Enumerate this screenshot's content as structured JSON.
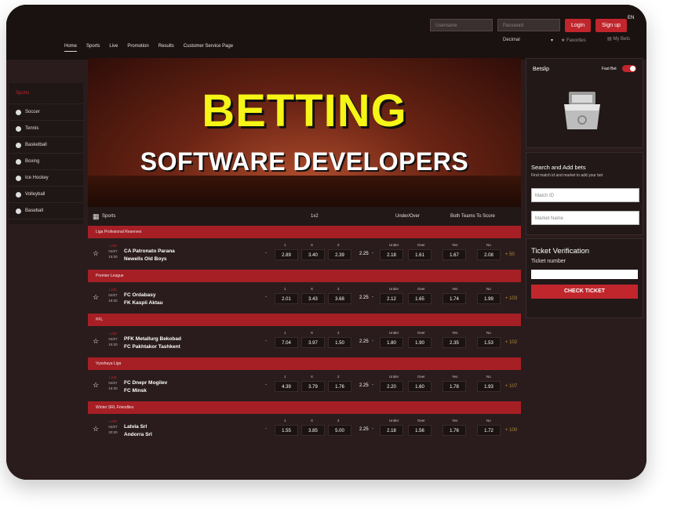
{
  "header": {
    "nav": [
      "Home",
      "Sports",
      "Live",
      "Promotion",
      "Results",
      "Customer Service Page"
    ],
    "username_placeholder": "Username",
    "password_placeholder": "Password",
    "login_label": "Login",
    "signup_label": "Sign up",
    "language": "EN",
    "odds_format": "Decimal",
    "favorites_label": "Favorites",
    "my_bets_label": "My Bets"
  },
  "sidebar": {
    "title": "Sports",
    "items": [
      "Soccer",
      "Tennis",
      "Basketball",
      "Boxing",
      "Ice Hockey",
      "Volleyball",
      "Baseball"
    ]
  },
  "banner": {
    "line1": "BETTING",
    "line2": "SOFTWARE DEVELOPERS"
  },
  "table": {
    "headers": {
      "sports": "Sports",
      "market1": "1x2",
      "market2": "Under/Over",
      "market3": "Both Teams To Score"
    },
    "odd_headers": {
      "h1": "1",
      "hx": "X",
      "h2": "2",
      "under": "Under",
      "over": "Over",
      "yes": "Yes",
      "no": "No"
    },
    "matches": [
      {
        "league": "Liga Profesional Reserves",
        "live": "LIVE",
        "date": "04/07",
        "time": "19:30",
        "home": "CA Patronato Parana",
        "away": "Newells Old Boys",
        "o1": "2.89",
        "ox": "3.40",
        "o2": "2.39",
        "handicap": "2.25",
        "under": "2.18",
        "over": "1.61",
        "yes": "1.67",
        "no": "2.08",
        "more": "+ 50"
      },
      {
        "league": "Premier League",
        "live": "LIVE",
        "date": "04/07",
        "time": "19:30",
        "home": "FC Ordabasy",
        "away": "FK Kaspii Aktau",
        "o1": "2.01",
        "ox": "3.43",
        "o2": "3.68",
        "handicap": "2.25",
        "under": "2.12",
        "over": "1.65",
        "yes": "1.74",
        "no": "1.99",
        "more": "+ 103"
      },
      {
        "league": "PFL",
        "live": "LIVE",
        "date": "04/07",
        "time": "19:30",
        "home": "PFK Metallurg Bekobad",
        "away": "FC Pakhtakor Tashkent",
        "o1": "7.04",
        "ox": "3.97",
        "o2": "1.50",
        "handicap": "2.25",
        "under": "1.80",
        "over": "1.90",
        "yes": "2.35",
        "no": "1.53",
        "more": "+ 102"
      },
      {
        "league": "Vysshaya Liga",
        "live": "LIVE",
        "date": "04/07",
        "time": "19:30",
        "home": "FC Dnepr Mogilev",
        "away": "FC Minsk",
        "o1": "4.39",
        "ox": "3.79",
        "o2": "1.76",
        "handicap": "2.25",
        "under": "2.20",
        "over": "1.60",
        "yes": "1.78",
        "no": "1.93",
        "more": "+ 107"
      },
      {
        "league": "Winter SRL Friendlies",
        "live": "LIVE",
        "date": "04/07",
        "time": "20:30",
        "home": "Latvia Srl",
        "away": "Andorra Srl",
        "o1": "1.55",
        "ox": "3.85",
        "o2": "5.00",
        "handicap": "2.25",
        "under": "2.18",
        "over": "1.56",
        "yes": "1.76",
        "no": "1.72",
        "more": "+ 100"
      }
    ]
  },
  "betslip": {
    "title": "Betslip",
    "fast_bet": "Fast Bet"
  },
  "search": {
    "title": "Search and Add bets",
    "desc": "Find match id and market to add your bet",
    "match_placeholder": "Match ID",
    "market_placeholder": "Market Name"
  },
  "ticket": {
    "title": "Ticket Verification",
    "number_label": "Ticket number",
    "check_label": "CHECK TICKET"
  },
  "colors": {
    "accent": "#c0262c",
    "banner_text": "#f5f516",
    "background": "#2a1c1c"
  }
}
